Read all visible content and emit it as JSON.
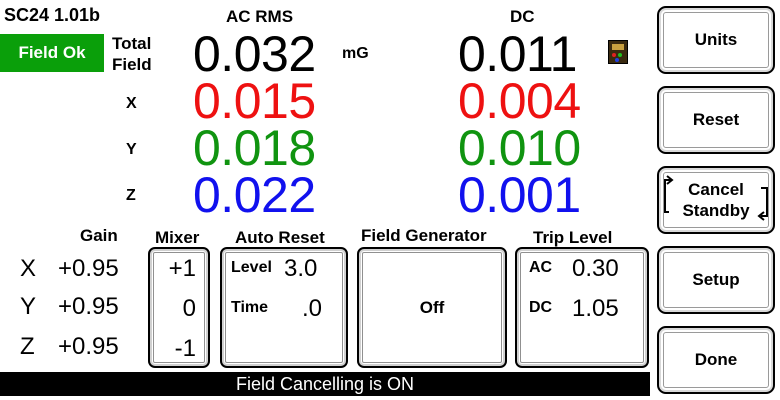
{
  "header": {
    "device": "SC24 1.01b",
    "status_badge": "Field Ok",
    "ac_title": "AC RMS",
    "dc_title": "DC",
    "unit": "mG"
  },
  "readings": {
    "total_label_line1": "Total",
    "total_label_line2": "Field",
    "axis_x": "X",
    "axis_y": "Y",
    "axis_z": "Z",
    "ac": {
      "total": "0.032",
      "x": "0.015",
      "y": "0.018",
      "z": "0.022"
    },
    "dc": {
      "total": "0.011",
      "x": "0.004",
      "y": "0.010",
      "z": "0.001"
    }
  },
  "colors": {
    "badge_green": "#0a9f0a",
    "x": "#ee1111",
    "y": "#109410",
    "z": "#1111ee",
    "bar": "#000000"
  },
  "controls": {
    "gain_title": "Gain",
    "mixer_title": "Mixer",
    "autoreset_title": "Auto Reset",
    "fieldgen_title": "Field Generator",
    "trip_title": "Trip Level",
    "rows": [
      {
        "axis": "X",
        "gain": "+0.95",
        "mixer": "+1"
      },
      {
        "axis": "Y",
        "gain": "+0.95",
        "mixer": "0"
      },
      {
        "axis": "Z",
        "gain": "+0.95",
        "mixer": "-1"
      }
    ],
    "autoreset": {
      "level_label": "Level",
      "level_value": "3.0",
      "time_label": "Time",
      "time_value": ".0"
    },
    "fieldgen_value": "Off",
    "trip": {
      "ac_label": "AC",
      "ac_value": "0.30",
      "dc_label": "DC",
      "dc_value": "1.05"
    }
  },
  "buttons": {
    "units": "Units",
    "reset": "Reset",
    "cancel_line1": "Cancel",
    "cancel_line2": "Standby",
    "setup": "Setup",
    "done": "Done"
  },
  "status_bar": "Field Cancelling is ON"
}
